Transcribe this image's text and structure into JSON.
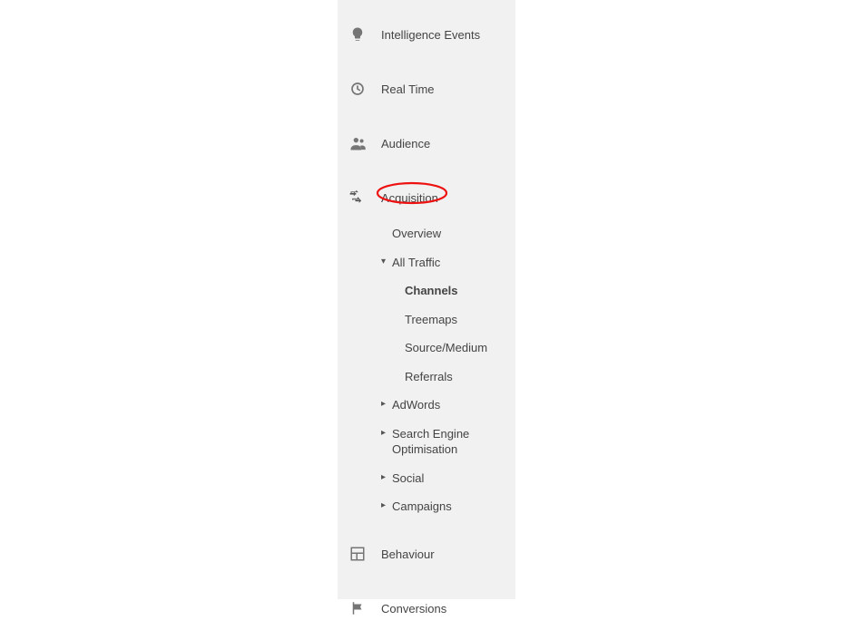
{
  "sidebar": {
    "top": [
      {
        "icon": "lightbulb-icon",
        "label": "Intelligence Events"
      },
      {
        "icon": "clock-icon",
        "label": "Real Time"
      },
      {
        "icon": "audience-icon",
        "label": "Audience"
      },
      {
        "icon": "acquisition-icon",
        "label": "Acquisition"
      },
      {
        "icon": "behaviour-icon",
        "label": "Behaviour"
      },
      {
        "icon": "flag-icon",
        "label": "Conversions"
      }
    ],
    "acquisition": {
      "overview": "Overview",
      "all_traffic": {
        "label": "All Traffic",
        "children": [
          "Channels",
          "Treemaps",
          "Source/Medium",
          "Referrals"
        ]
      },
      "adwords": "AdWords",
      "seo": "Search Engine Optimisation",
      "social": "Social",
      "campaigns": "Campaigns"
    }
  },
  "annotation": {
    "target": "Acquisition",
    "color": "#e11"
  }
}
